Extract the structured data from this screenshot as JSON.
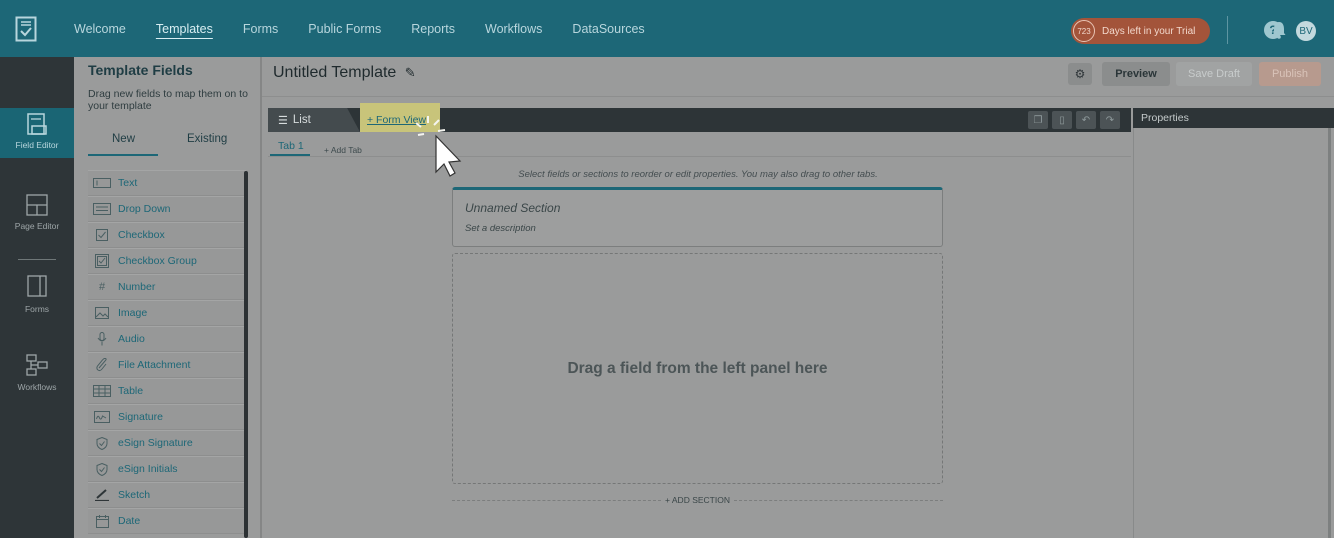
{
  "nav": {
    "items": [
      "Welcome",
      "Templates",
      "Forms",
      "Public Forms",
      "Reports",
      "Workflows",
      "DataSources"
    ],
    "active": "Templates"
  },
  "trial": {
    "days": "723",
    "label": "Days left in your Trial"
  },
  "user": {
    "initials": "BV"
  },
  "rail": {
    "items": [
      "Field Editor",
      "Page Editor",
      "Forms",
      "Workflows"
    ]
  },
  "fieldpanel": {
    "title": "Template Fields",
    "subtitle": "Drag new fields to map them on to your template",
    "tab_new": "New",
    "tab_existing": "Existing",
    "fields": [
      "Text",
      "Drop Down",
      "Checkbox",
      "Checkbox Group",
      "Number",
      "Image",
      "Audio",
      "File Attachment",
      "Table",
      "Signature",
      "eSign Signature",
      "eSign Initials",
      "Sketch",
      "Date"
    ]
  },
  "main": {
    "title": "Untitled Template",
    "preview": "Preview",
    "save_draft": "Save Draft",
    "publish": "Publish",
    "list_tab": "List",
    "form_view_tab": "+ Form View",
    "tab1": "Tab 1",
    "add_tab": "+ Add Tab",
    "hint": "Select fields or sections to reorder or edit properties. You may also drag to other tabs.",
    "section_name": "Unnamed Section",
    "section_desc": "Set a description",
    "dropzone": "Drag a field from the left panel here",
    "add_section": "+ ADD SECTION"
  },
  "props": {
    "title": "Properties"
  },
  "colors": {
    "topbar": "#1d6777",
    "rail": "#2e3538",
    "accent": "#1d6777",
    "trial": "#a3543a",
    "highlight": "#c8c47a"
  }
}
